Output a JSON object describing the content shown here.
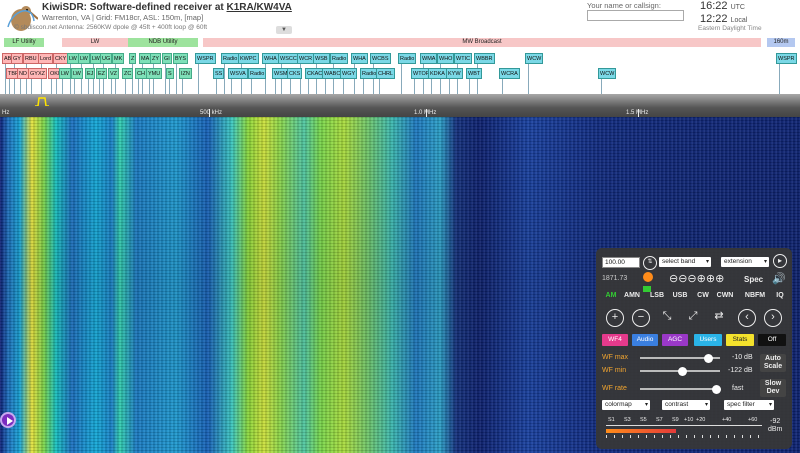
{
  "header": {
    "title_prefix": "KiwiSDR: Software-defined receiver at ",
    "callsign": "K1RA/KW4VA",
    "location": "Warrenton, VA | Grid: FM18cr, ASL: 150m, [map]",
    "antenna": "© sbdiscon.net Antenna: 2560KW dpole @ 45ft + 400ft loop @ 60ft",
    "user_label": "Your name or callsign:",
    "user_value": "",
    "utc_time": "16:22",
    "utc_label": "UTC",
    "local_time": "12:22",
    "local_label": "Local",
    "tz": "Eastern Daylight Time"
  },
  "bands": [
    {
      "label": "LF Utility",
      "color": "#9de39d"
    },
    {
      "label": "LW",
      "color": "#f7c7c7"
    },
    {
      "label": "NDB Utility",
      "color": "#9de39d"
    },
    {
      "label": "MW Broadcast",
      "color": "#f7c7c7"
    },
    {
      "label": "160m",
      "color": "#b4c8f0"
    }
  ],
  "stations_row1": [
    "AB",
    "GY",
    "RBU",
    "Lord",
    "CKY",
    "LW",
    "LW",
    "LW",
    "UG",
    "MK",
    "Z",
    "MA",
    "ZY",
    "GI",
    "BYS",
    "WSPR",
    "Radio",
    "KWPC",
    "WHA",
    "WSCC",
    "WCR",
    "WSB",
    "Radio",
    "WHA",
    "WCBS",
    "Radio",
    "WMA",
    "WHO",
    "WTIC",
    "WBBR",
    "WCW",
    "WSPR"
  ],
  "stations_row2": [
    "TBR",
    "ND",
    "GYXZ",
    "OKI",
    "LW",
    "LW",
    "EJ",
    "EZ",
    "VZ",
    "ZC",
    "CH",
    "YMU",
    "S",
    "IZN",
    "SS",
    "WSVA",
    "Radio",
    "WSM",
    "CKS",
    "CKAC",
    "WABC",
    "WGY",
    "Radio",
    "CHRL",
    "WTOP",
    "KDKA",
    "KYW",
    "WBT",
    "WCRA",
    "WCW"
  ],
  "scale": {
    "ticks": [
      "Hz",
      "500 kHz",
      "1.0 MHz",
      "1.5 MHz"
    ]
  },
  "panel": {
    "freq_value": "100.00",
    "select_band": "select band",
    "extension": "extension",
    "status_num": "1871.73",
    "spec_label": "Spec",
    "modes": [
      "AM",
      "AMN",
      "LSB",
      "USB",
      "CW",
      "CWN",
      "NBFM",
      "IQ"
    ],
    "active_mode": "AM",
    "tabs": [
      {
        "label": "WF4",
        "bg": "#e53a8c",
        "fg": "#fff"
      },
      {
        "label": "Audio",
        "bg": "#3a7fe0",
        "fg": "#fff"
      },
      {
        "label": "AGC",
        "bg": "#9a38c8",
        "fg": "#fff"
      },
      {
        "label": "Users",
        "bg": "#2ab4e8",
        "fg": "#fff"
      },
      {
        "label": "Stats",
        "bg": "#f4e22c",
        "fg": "#222"
      },
      {
        "label": "Off",
        "bg": "#111",
        "fg": "#fff"
      }
    ],
    "wf_max_label": "WF max",
    "wf_max_value": "-10 dB",
    "wf_max_level": 0.9,
    "wf_min_label": "WF min",
    "wf_min_value": "-122 dB",
    "wf_min_level": 0.55,
    "wf_rate_label": "WF rate",
    "wf_rate_value": "fast",
    "wf_rate_level": 1.0,
    "auto_scale": "Auto Scale",
    "slow_dev": "Slow Dev",
    "colormap": "colormap",
    "contrast": "contrast",
    "spec_filter": "spec filter",
    "smeter_labels": [
      "S1",
      "S3",
      "S5",
      "S7",
      "S9",
      "+10",
      "+20",
      "+40",
      "+60"
    ],
    "dbm_value": "-92",
    "dbm_unit": "dBm",
    "smeter_level": 0.45
  }
}
